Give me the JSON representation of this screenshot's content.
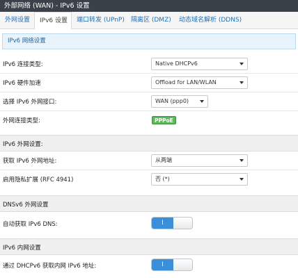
{
  "window": {
    "title": "外部网络 (WAN) - IPv6 设置"
  },
  "tabs": [
    {
      "label": "外网设置"
    },
    {
      "label": "IPv6 设置"
    },
    {
      "label": "端口转发 (UPnP)"
    },
    {
      "label": "隔离区 (DMZ)"
    },
    {
      "label": "动态域名解析 (DDNS)"
    }
  ],
  "info_title": "IPv6 网络设置",
  "fields": {
    "connection_type": {
      "label": "IPv6 连接类型:",
      "value": "Native DHCPv6"
    },
    "hw_accel": {
      "label": "IPv6 硬件加速",
      "value": "Offload for LAN/WLAN"
    },
    "wan_interface": {
      "label": "选择 IPv6 外网接口:",
      "value": "WAN (ppp0)"
    },
    "wan_conn_type": {
      "label": "外网连接类型:",
      "value": "PPPoE"
    }
  },
  "sections": {
    "wan": "IPv6 外网设置:",
    "dns": "DNSv6 外网设置",
    "lan": "IPv6 内网设置"
  },
  "wan_settings": {
    "get_address": {
      "label": "获取 IPv6 外网地址:",
      "value": "从两端"
    },
    "privacy_ext": {
      "label": "启用隐私扩展 (RFC 4941)",
      "value": "否 (*)"
    }
  },
  "dns_settings": {
    "auto_dns": {
      "label": "自动获取 IPv6 DNS:",
      "toggle_on": "I"
    }
  },
  "lan_settings": {
    "dhcpv6_addr": {
      "label": "通过 DHCPv6 获取内网 IPv6 地址:",
      "toggle_on": "I"
    }
  }
}
